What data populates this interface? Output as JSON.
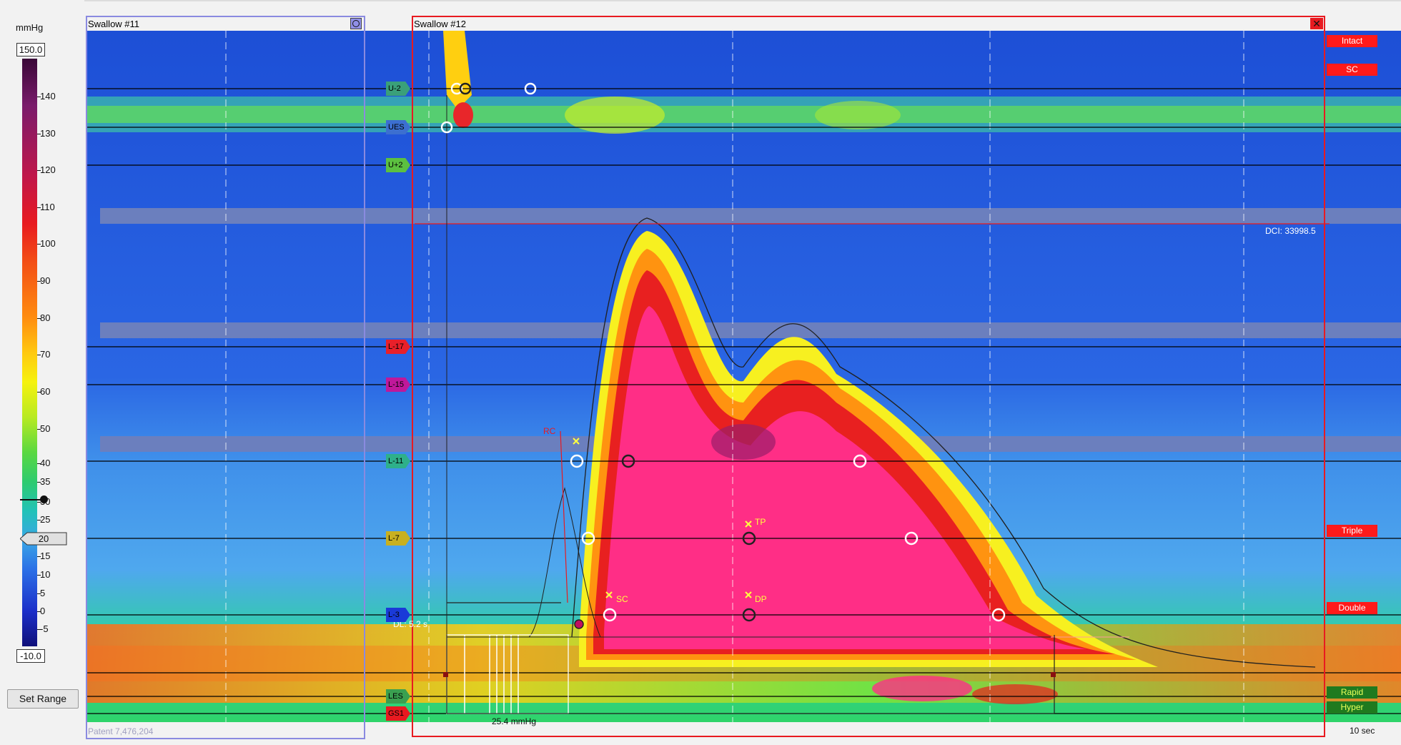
{
  "scale": {
    "unit": "mmHg",
    "max": "150.0",
    "min": "-10.0",
    "ticks": [
      "140",
      "130",
      "120",
      "110",
      "100",
      "90",
      "80",
      "70",
      "60",
      "50",
      "40",
      "35",
      "30",
      "25",
      "20",
      "15",
      "10",
      "5",
      "0",
      "-5"
    ],
    "set_range_label": "Set Range"
  },
  "swallow_11": {
    "title": "Swallow #11",
    "patent": "Patent 7,476,204"
  },
  "swallow_12": {
    "title": "Swallow #12",
    "dci": "DCI: 33998.5",
    "dl": "DL: 5.2 s",
    "irp": "25.4 mmHg",
    "rc": "RC",
    "tp": "TP",
    "dp": "DP",
    "sc": "SC"
  },
  "sensors": [
    "U-2",
    "UES",
    "U+2",
    "L-17",
    "L-15",
    "L-11",
    "L-7",
    "L-3",
    "LES",
    "GS1"
  ],
  "classification": {
    "intact": "Intact",
    "sc": "SC",
    "triple": "Triple",
    "double": "Double",
    "rapid": "Rapid",
    "hyper": "Hyper"
  },
  "timebar": {
    "label": "10 sec"
  }
}
